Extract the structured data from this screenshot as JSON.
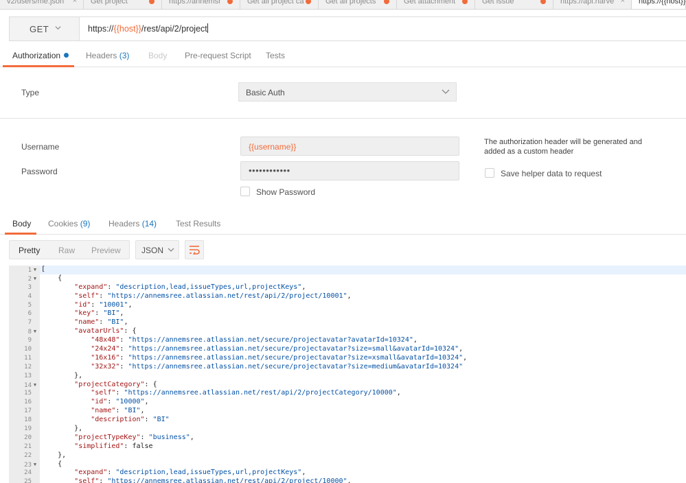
{
  "request_tabs": [
    {
      "label": "v2/users/me.json",
      "marker": "close"
    },
    {
      "label": "Get project",
      "marker": "dot"
    },
    {
      "label": "https://annemsr",
      "marker": "dot"
    },
    {
      "label": "Get all project ca",
      "marker": "dot"
    },
    {
      "label": "Get all projects",
      "marker": "dot"
    },
    {
      "label": "Get attachment",
      "marker": "dot"
    },
    {
      "label": "Get issue",
      "marker": "dot"
    },
    {
      "label": "https://api.harve",
      "marker": "close"
    },
    {
      "label": "https://{{host}}",
      "marker": "none"
    }
  ],
  "request": {
    "method": "GET",
    "url_prefix": "https://",
    "url_var": "{{host}}",
    "url_suffix": "/rest/api/2/project"
  },
  "subtabs": {
    "authorization": "Authorization",
    "headers": "Headers",
    "headers_count": "(3)",
    "body": "Body",
    "prerequest": "Pre-request Script",
    "tests": "Tests"
  },
  "auth": {
    "type_label": "Type",
    "type_value": "Basic Auth",
    "username_label": "Username",
    "username_value": "{{username}}",
    "password_label": "Password",
    "password_value": "••••••••••••",
    "show_password_label": "Show Password",
    "helper_note": "The authorization header will be generated and added as a custom header",
    "save_helper_label": "Save helper data to request"
  },
  "response_tabs": {
    "body": "Body",
    "cookies": "Cookies",
    "cookies_count": "(9)",
    "headers": "Headers",
    "headers_count": "(14)",
    "test_results": "Test Results"
  },
  "view": {
    "pretty": "Pretty",
    "raw": "Raw",
    "preview": "Preview",
    "format": "JSON"
  },
  "code_lines": [
    {
      "n": "1",
      "fold": true,
      "text": "["
    },
    {
      "n": "2",
      "fold": true,
      "text": "    {"
    },
    {
      "n": "3",
      "fold": false,
      "text": "        \"expand\": \"description,lead,issueTypes,url,projectKeys\","
    },
    {
      "n": "4",
      "fold": false,
      "text": "        \"self\": \"https://annemsree.atlassian.net/rest/api/2/project/10001\","
    },
    {
      "n": "5",
      "fold": false,
      "text": "        \"id\": \"10001\","
    },
    {
      "n": "6",
      "fold": false,
      "text": "        \"key\": \"BI\","
    },
    {
      "n": "7",
      "fold": false,
      "text": "        \"name\": \"BI\","
    },
    {
      "n": "8",
      "fold": true,
      "text": "        \"avatarUrls\": {"
    },
    {
      "n": "9",
      "fold": false,
      "text": "            \"48x48\": \"https://annemsree.atlassian.net/secure/projectavatar?avatarId=10324\","
    },
    {
      "n": "10",
      "fold": false,
      "text": "            \"24x24\": \"https://annemsree.atlassian.net/secure/projectavatar?size=small&avatarId=10324\","
    },
    {
      "n": "11",
      "fold": false,
      "text": "            \"16x16\": \"https://annemsree.atlassian.net/secure/projectavatar?size=xsmall&avatarId=10324\","
    },
    {
      "n": "12",
      "fold": false,
      "text": "            \"32x32\": \"https://annemsree.atlassian.net/secure/projectavatar?size=medium&avatarId=10324\""
    },
    {
      "n": "13",
      "fold": false,
      "text": "        },"
    },
    {
      "n": "14",
      "fold": true,
      "text": "        \"projectCategory\": {"
    },
    {
      "n": "15",
      "fold": false,
      "text": "            \"self\": \"https://annemsree.atlassian.net/rest/api/2/projectCategory/10000\","
    },
    {
      "n": "16",
      "fold": false,
      "text": "            \"id\": \"10000\","
    },
    {
      "n": "17",
      "fold": false,
      "text": "            \"name\": \"BI\","
    },
    {
      "n": "18",
      "fold": false,
      "text": "            \"description\": \"BI\""
    },
    {
      "n": "19",
      "fold": false,
      "text": "        },"
    },
    {
      "n": "20",
      "fold": false,
      "text": "        \"projectTypeKey\": \"business\","
    },
    {
      "n": "21",
      "fold": false,
      "text": "        \"simplified\": false"
    },
    {
      "n": "22",
      "fold": false,
      "text": "    },"
    },
    {
      "n": "23",
      "fold": true,
      "text": "    {"
    },
    {
      "n": "24",
      "fold": false,
      "text": "        \"expand\": \"description,lead,issueTypes,url,projectKeys\","
    },
    {
      "n": "25",
      "fold": false,
      "text": "        \"self\": \"https://annemsree.atlassian.net/rest/api/2/project/10000\","
    }
  ],
  "colors": {
    "accent": "#f26b3a",
    "link_blue": "#1a75bc",
    "json_key": "#a31515",
    "json_string": "#0451a5"
  }
}
